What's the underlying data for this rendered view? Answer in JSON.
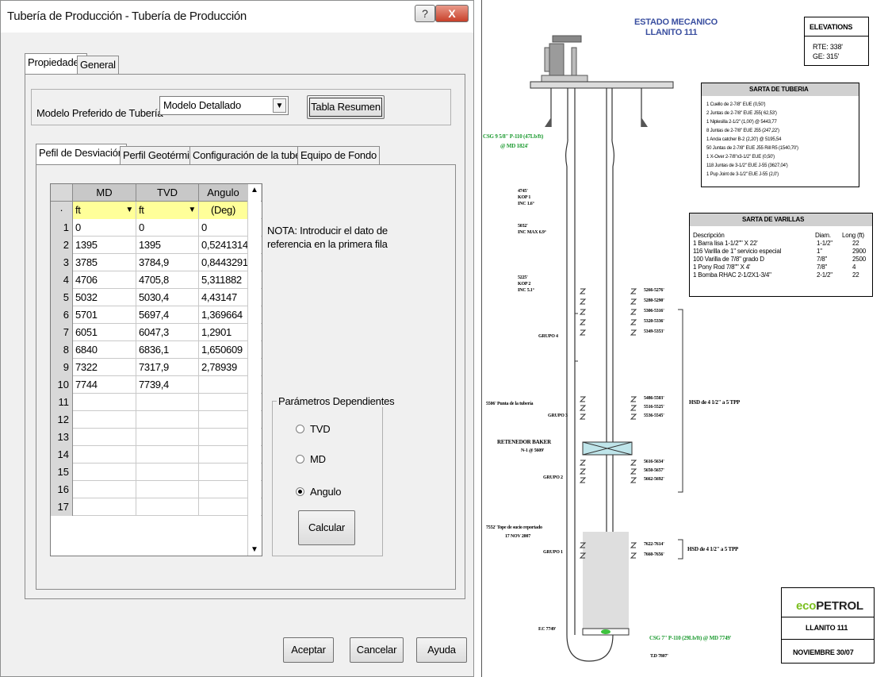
{
  "dialog": {
    "title": "Tubería de Producción - Tubería de Producción",
    "help_glyph": "?",
    "close_glyph": "X",
    "outer_tabs": [
      "Propiedades",
      "General"
    ],
    "modelo_label": "Modelo Preferido de Tubería",
    "modelo_value": "Modelo Detallado",
    "tabla_resumen": "Tabla Resumen",
    "inner_tabs": [
      "Pefil de Desviación",
      "Perfil Geotérmico",
      "Configuración de la tubería",
      "Equipo de Fondo"
    ],
    "grid": {
      "headers": [
        "MD",
        "TVD",
        "Angulo"
      ],
      "unit_row_label": "·",
      "units": [
        "ft",
        "ft",
        "(Deg)"
      ],
      "rows": [
        {
          "n": "1",
          "md": "0",
          "tvd": "0",
          "ang": "0"
        },
        {
          "n": "2",
          "md": "1395",
          "tvd": "1395",
          "ang": "0,5241314"
        },
        {
          "n": "3",
          "md": "3785",
          "tvd": "3784,9",
          "ang": "0,8443291"
        },
        {
          "n": "4",
          "md": "4706",
          "tvd": "4705,8",
          "ang": "5,311882"
        },
        {
          "n": "5",
          "md": "5032",
          "tvd": "5030,4",
          "ang": "4,43147"
        },
        {
          "n": "6",
          "md": "5701",
          "tvd": "5697,4",
          "ang": "1,369664"
        },
        {
          "n": "7",
          "md": "6051",
          "tvd": "6047,3",
          "ang": "1,2901"
        },
        {
          "n": "8",
          "md": "6840",
          "tvd": "6836,1",
          "ang": "1,650609"
        },
        {
          "n": "9",
          "md": "7322",
          "tvd": "7317,9",
          "ang": "2,78939"
        },
        {
          "n": "10",
          "md": "7744",
          "tvd": "7739,4",
          "ang": ""
        },
        {
          "n": "11",
          "md": "",
          "tvd": "",
          "ang": ""
        },
        {
          "n": "12",
          "md": "",
          "tvd": "",
          "ang": ""
        },
        {
          "n": "13",
          "md": "",
          "tvd": "",
          "ang": ""
        },
        {
          "n": "14",
          "md": "",
          "tvd": "",
          "ang": ""
        },
        {
          "n": "15",
          "md": "",
          "tvd": "",
          "ang": ""
        },
        {
          "n": "16",
          "md": "",
          "tvd": "",
          "ang": ""
        },
        {
          "n": "17",
          "md": "",
          "tvd": "",
          "ang": ""
        }
      ]
    },
    "nota": [
      "NOTA: Introducir el dato de",
      "referencia en la primera fila"
    ],
    "parametros": {
      "legend": "Parámetros Dependientes",
      "options": [
        "TVD",
        "MD",
        "Angulo"
      ],
      "selected": "Angulo",
      "calcular": "Calcular"
    },
    "buttons": {
      "aceptar": "Aceptar",
      "cancelar": "Cancelar",
      "ayuda": "Ayuda"
    }
  },
  "diagram": {
    "title_line1": "ESTADO MECANICO",
    "title_line2": "LLANITO 111",
    "elevations": {
      "heading": "ELEVATIONS",
      "rte": "RTE:  338'",
      "ge": "GE:  315'"
    },
    "sarta_tuberia": {
      "heading": "SARTA DE TUBERIA",
      "lines": [
        "1    Cuello de 2-7/8\"  EUE  (0,50')",
        "2    Juntas de 2-7/8\"  EUE  J55( 62,53')",
        "1    Niplesilla  2-1/2\"  (1,00') @ 5443,77",
        "8    Juntas de 2-7/8\"  EUE  J55 (247,22')",
        "1    Ancla catcher  B-2 (2,20') @ 5195,54",
        "50   Juntas de 2-7/8\"  EUE  J55 Rill R5 (1540,70')",
        "1    X-Over 2-7/8\"x3-1/2\"  EUE  (0,50')",
        "118  Juntas de 3-1/2\"  EUE  J-55 (3627,04')",
        "1    Pup Joint  de 3-1/2\"  EUE  J-55 (2,0')"
      ]
    },
    "sarta_varillas": {
      "heading": "SARTA DE VARILLAS",
      "col_desc": "Descripción",
      "col_diam": "Diam.",
      "col_long": "Long (ft)",
      "rows": [
        {
          "desc": "1    Barra lisa  1-1/2\"\" X 22'",
          "diam": "1-1/2\"",
          "long": "22"
        },
        {
          "desc": "116 Varilla de 1\"  servicio especial",
          "diam": "1\"",
          "long": "2900"
        },
        {
          "desc": "100 Varilla de 7/8\" grado D",
          "diam": "7/8\"",
          "long": "2500"
        },
        {
          "desc": "1    Pony Rod   7/8\"\" X 4'",
          "diam": "7/8\"",
          "long": "4"
        },
        {
          "desc": "1    Bomba RHAC 2-1/2X1-3/4\"",
          "diam": "2-1/2\"",
          "long": "22"
        }
      ]
    },
    "casing_top": [
      "CSG 9 5/8\" P-110 (47Lb/ft)",
      "@  MD 1824'"
    ],
    "survey_notes": [
      [
        "4745'",
        "KOP 1",
        "INC 1.6°"
      ],
      [
        "5032'",
        "INC MAX 6.9°"
      ],
      [
        "5225'",
        "KOP 2",
        "INC 5.1°"
      ]
    ],
    "perfs": {
      "grupo4": [
        "5266-5276'",
        "5280-5290'",
        "5306-5316'",
        "5320-5336'",
        "5349-5353'"
      ],
      "grupo3": [
        "5486-5503'",
        "5516-5525'",
        "5536-5545'"
      ],
      "grupo2": [
        "5616-5634'",
        "5650-5657'",
        "5662-5692'"
      ],
      "grupo1": [
        "7622-7614'",
        "7660-7656'"
      ]
    },
    "labels": {
      "grupo4": "GRUPO 4",
      "grupo3": "GRUPO 3",
      "grupo2": "GRUPO 2",
      "grupo1": "GRUPO 1",
      "punta": "5506' Punta de la tubería",
      "retenedor1": "RETENEDOR  BAKER",
      "retenedor2": "N-1 @ 5609'",
      "hsd_upper": "HSD de 4  1/2\"  a 5  TPP",
      "hsd_lower": "HSD de 4  1/2\"  a 5  TPP",
      "tope1": "7552' Tope de sucio reportado",
      "tope2": "17 NOV 2007",
      "fc": "F.C  7749'",
      "casing_bottom": "CSG 7\" P-110 (29Lb/ft) @  MD 7749'",
      "td": "T.D  7807'"
    },
    "footer": {
      "logo_prefix": "eco",
      "logo_main": "PETROL",
      "well": "LLANITO 111",
      "date": "NOVIEMBRE 30/07"
    }
  }
}
